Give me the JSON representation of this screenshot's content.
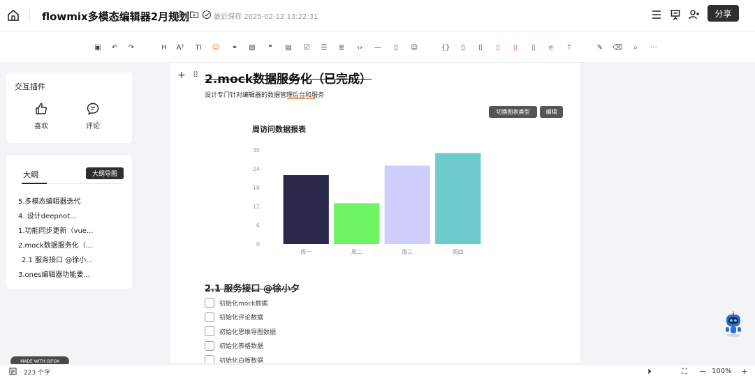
{
  "header": {
    "title": "flowmix多模态编辑器2月规划",
    "save_status": "最近保存 2025-02-12 13:22:31",
    "share_label": "分享"
  },
  "toolbar": {
    "items": [
      {
        "icon": "save-icon",
        "glyph": "▣"
      },
      {
        "icon": "undo-icon",
        "glyph": "↶"
      },
      {
        "icon": "redo-icon",
        "glyph": "↷"
      },
      {
        "icon": "heading-icon",
        "glyph": "H"
      },
      {
        "icon": "font-size-icon",
        "glyph": "A²"
      },
      {
        "icon": "text-style-icon",
        "glyph": "TI"
      },
      {
        "icon": "emoji-color-icon",
        "glyph": "☺"
      },
      {
        "icon": "link-icon",
        "glyph": "⚭"
      },
      {
        "icon": "image-icon",
        "glyph": "▨"
      },
      {
        "icon": "quote-icon",
        "glyph": "❝"
      },
      {
        "icon": "table-icon",
        "glyph": "▤"
      },
      {
        "icon": "checkbox-icon",
        "glyph": "☑"
      },
      {
        "icon": "bullet-list-icon",
        "glyph": "☰"
      },
      {
        "icon": "ordered-list-icon",
        "glyph": "≣"
      },
      {
        "icon": "code-icon",
        "glyph": "‹›"
      },
      {
        "icon": "divider-icon",
        "glyph": "—"
      },
      {
        "icon": "file-icon",
        "glyph": "▯"
      },
      {
        "icon": "emoji-icon",
        "glyph": "☺"
      },
      {
        "icon": "code-block-icon",
        "glyph": "{}"
      },
      {
        "icon": "doc-icon",
        "glyph": "▯"
      },
      {
        "icon": "page-icon",
        "glyph": "▯"
      },
      {
        "icon": "pdf-icon",
        "glyph": "▯"
      },
      {
        "icon": "ppt-icon",
        "glyph": "▯"
      },
      {
        "icon": "word-icon",
        "glyph": "▯"
      },
      {
        "icon": "e-icon",
        "glyph": "e"
      },
      {
        "icon": "branch-icon",
        "glyph": "ᛘ"
      },
      {
        "icon": "brush-icon",
        "glyph": "✎"
      },
      {
        "icon": "clear-format-icon",
        "glyph": "⌫"
      },
      {
        "icon": "search-icon",
        "glyph": "⌕"
      },
      {
        "icon": "more-icon",
        "glyph": "···"
      }
    ]
  },
  "plugins": {
    "title": "交互插件",
    "items": [
      {
        "label": "喜欢",
        "icon": "thumbs-up-icon"
      },
      {
        "label": "评论",
        "icon": "comment-icon"
      }
    ]
  },
  "outline": {
    "tab_label": "大纲",
    "mindmap_button": "大纲导图",
    "items": [
      "5.多模态编辑器迭代",
      "4. 设计deepnot...",
      "1.功能同步更新（vue...",
      "2.mock数据服务化（...",
      "2.1 服务接口 @徐小...",
      "3.ones编辑器功能要..."
    ]
  },
  "document": {
    "heading": "2.mock数据服务化（已完成）",
    "description": "设计专门针对编辑器的数据管理后台和服务",
    "chart_buttons": [
      "切换图表类型",
      "编辑"
    ],
    "subheading": "2.1 服务接口 @徐小夕",
    "todos": [
      "初始化mock数据",
      "初始化评论数据",
      "初始化思维导图数据",
      "初始化表格数据",
      "初始化白板数据"
    ]
  },
  "chart_data": {
    "type": "bar",
    "title": "周访问数据报表",
    "categories": [
      "周一",
      "周二",
      "周三",
      "周四"
    ],
    "values": [
      22,
      13,
      25,
      29
    ],
    "colors": [
      "#2b2a4c",
      "#6ef462",
      "#cfcdfb",
      "#6ecbcb"
    ],
    "ylim": [
      0,
      30
    ],
    "yticks": [
      0,
      6,
      12,
      18,
      24,
      30
    ],
    "xlabel": "",
    "ylabel": "",
    "grid": false
  },
  "status": {
    "word_count": "223 个字",
    "zoom": "100%"
  },
  "badge": {
    "made_with": "MADE WITH GIFOX"
  }
}
